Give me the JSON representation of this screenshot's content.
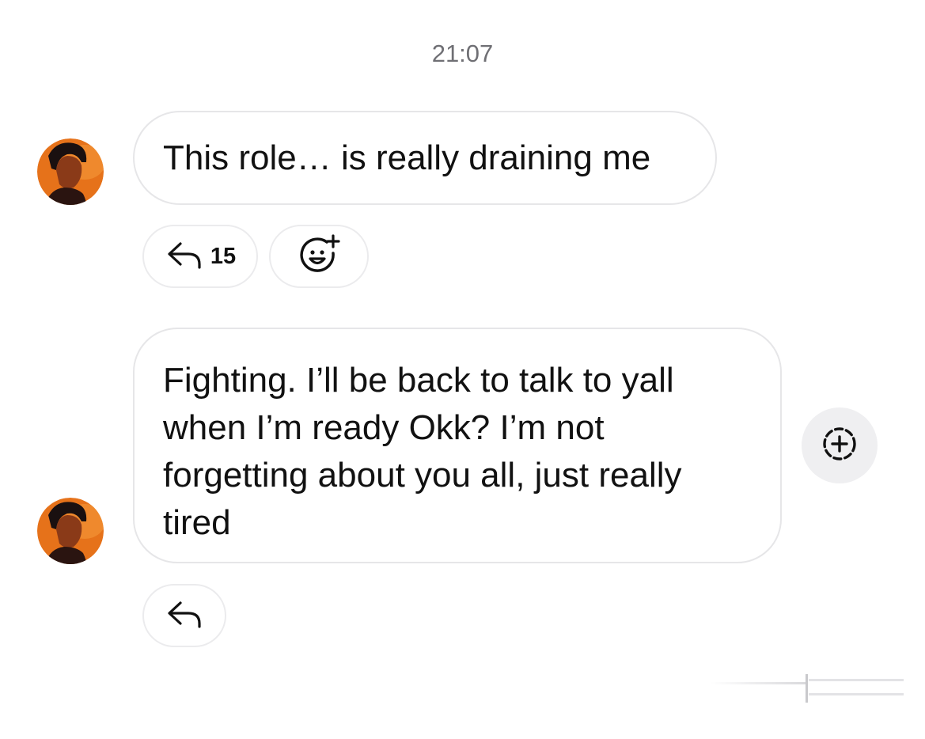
{
  "timestamp": "21:07",
  "messages": [
    {
      "text": "This role… is really draining me",
      "reply_count": "15",
      "avatar_icon": "user-avatar"
    },
    {
      "text": "Fighting. I’ll be back to talk to yall when I’m ready Okk? I’m not forgetting about you all, just really tired",
      "avatar_icon": "user-avatar"
    }
  ],
  "icons": {
    "reply": "reply-arrow-icon",
    "add_reaction": "add-reaction-icon",
    "add": "add-circle-icon"
  },
  "colors": {
    "avatar_background": "#e6721a",
    "bubble_border": "#e6e6e8",
    "timestamp": "#6f6f74",
    "add_button_bg": "#efeff1"
  }
}
